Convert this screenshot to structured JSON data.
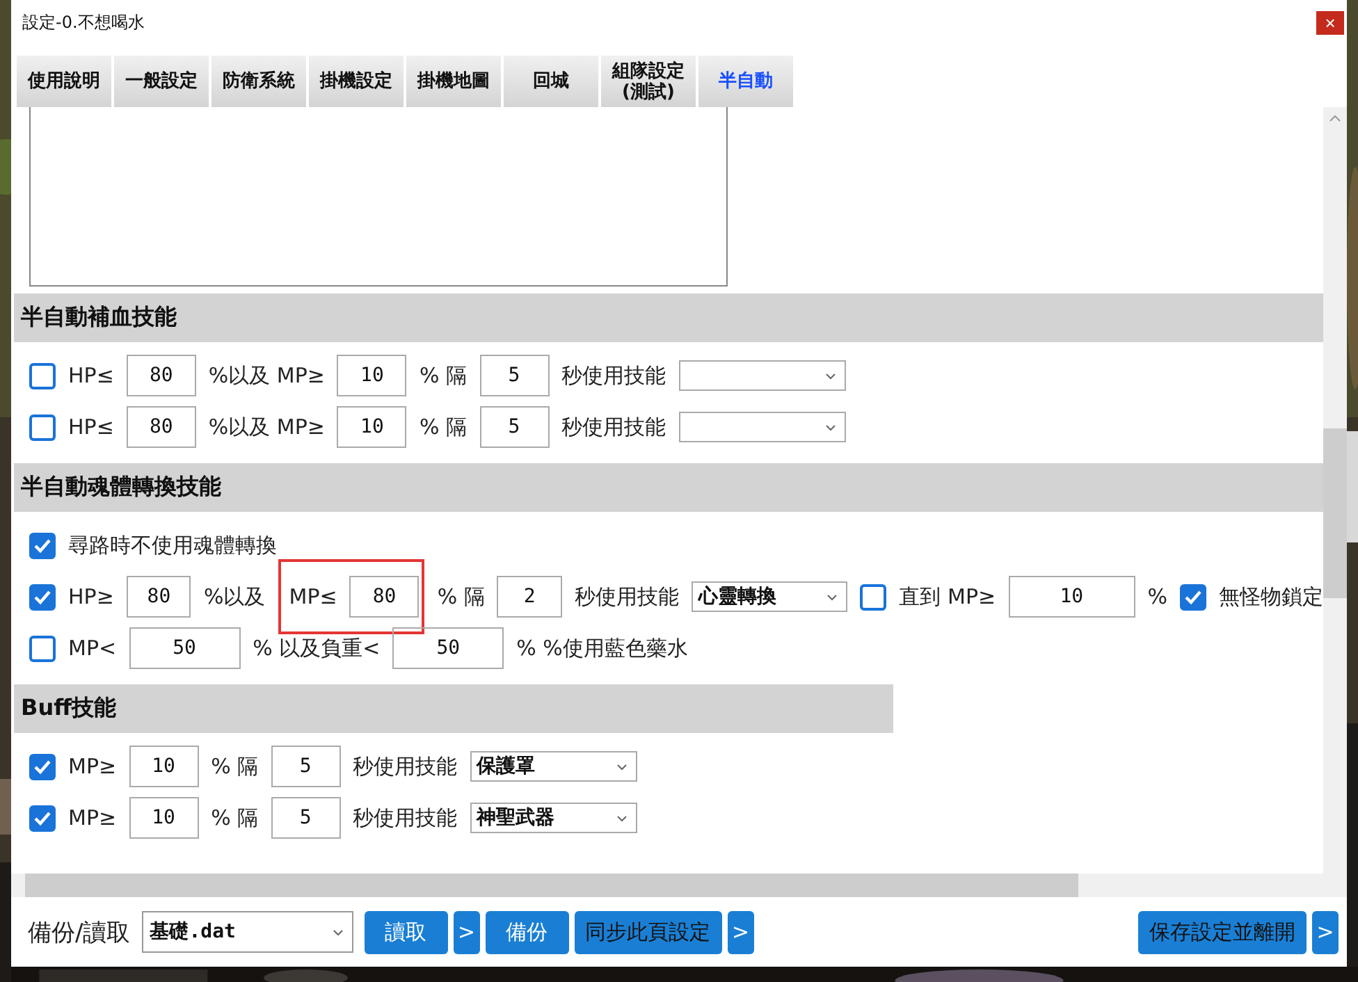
{
  "window": {
    "title": "設定-0.不想喝水",
    "close": "×"
  },
  "tabs": [
    {
      "label": "使用說明",
      "selected": false
    },
    {
      "label": "一般設定",
      "selected": false
    },
    {
      "label": "防衛系統",
      "selected": false
    },
    {
      "label": "掛機設定",
      "selected": false
    },
    {
      "label": "掛機地圖",
      "selected": false
    },
    {
      "label": "回城",
      "selected": false
    },
    {
      "label": "組隊設定\n(測試)",
      "selected": false
    },
    {
      "label": "半自動",
      "selected": true
    }
  ],
  "sections": [
    {
      "title": "半自動補血技能",
      "kind": "wide",
      "rows": [
        {
          "items": [
            {
              "kind": "check",
              "checked": false
            },
            {
              "kind": "label",
              "text": "HP≤"
            },
            {
              "kind": "input",
              "value": "80"
            },
            {
              "kind": "label",
              "text": "%以及 MP≥"
            },
            {
              "kind": "input",
              "value": "10"
            },
            {
              "kind": "label",
              "text": "% 隔"
            },
            {
              "kind": "input",
              "value": "5"
            },
            {
              "kind": "label",
              "text": "秒使用技能"
            },
            {
              "kind": "select"
            }
          ]
        },
        {
          "items": [
            {
              "kind": "check",
              "checked": false
            },
            {
              "kind": "label",
              "text": "HP≤"
            },
            {
              "kind": "input",
              "value": "80"
            },
            {
              "kind": "label",
              "text": "%以及 MP≥"
            },
            {
              "kind": "input",
              "value": "10"
            },
            {
              "kind": "label",
              "text": "% 隔"
            },
            {
              "kind": "input",
              "value": "5"
            },
            {
              "kind": "label",
              "text": "秒使用技能"
            },
            {
              "kind": "select"
            }
          ]
        }
      ]
    },
    {
      "title": "半自動魂體轉換技能",
      "kind": "wide",
      "rows": [
        {
          "items": [
            {
              "kind": "check",
              "checked": true
            },
            {
              "kind": "label",
              "text": "尋路時不使用魂體轉換"
            }
          ]
        },
        {
          "items": [
            {
              "kind": "check",
              "checked": true
            },
            {
              "kind": "label",
              "text": "HP≥"
            },
            {
              "kind": "input",
              "value": "80"
            },
            {
              "kind": "label",
              "text": "%以及"
            },
            {
              "kind": "highlight",
              "items": [
                {
                  "kind": "label",
                  "text": "MP≤"
                },
                {
                  "kind": "input",
                  "value": "80"
                }
              ]
            },
            {
              "kind": "label",
              "text": "% 隔"
            },
            {
              "kind": "input",
              "value": "2"
            },
            {
              "kind": "label",
              "text": "秒使用技能"
            },
            {
              "kind": "select",
              "value": "心靈轉換"
            },
            {
              "kind": "check",
              "checked": false
            },
            {
              "kind": "label",
              "text": "直到 MP≥"
            },
            {
              "kind": "input-wide",
              "value": "10"
            },
            {
              "kind": "label",
              "text": "%"
            },
            {
              "kind": "check",
              "checked": true
            },
            {
              "kind": "label",
              "text": "無怪物鎖定"
            }
          ]
        },
        {
          "items": [
            {
              "kind": "check",
              "checked": false
            },
            {
              "kind": "label",
              "text": "MP<"
            },
            {
              "kind": "input-mid",
              "value": "50"
            },
            {
              "kind": "label",
              "text": "% 以及負重<"
            },
            {
              "kind": "input-mid",
              "value": "50"
            },
            {
              "kind": "label",
              "text": "% %使用藍色藥水"
            }
          ]
        }
      ]
    },
    {
      "title": "Buff技能",
      "kind": "narrow",
      "rows": [
        {
          "items": [
            {
              "kind": "check",
              "checked": true
            },
            {
              "kind": "label",
              "text": "MP≥"
            },
            {
              "kind": "input",
              "value": "10"
            },
            {
              "kind": "label",
              "text": "% 隔"
            },
            {
              "kind": "input",
              "value": "5"
            },
            {
              "kind": "label",
              "text": "秒使用技能"
            },
            {
              "kind": "select",
              "value": "保護罩"
            }
          ]
        },
        {
          "items": [
            {
              "kind": "check",
              "checked": true
            },
            {
              "kind": "label",
              "text": "MP≥"
            },
            {
              "kind": "input",
              "value": "10"
            },
            {
              "kind": "label",
              "text": "% 隔"
            },
            {
              "kind": "input",
              "value": "5"
            },
            {
              "kind": "label",
              "text": "秒使用技能"
            },
            {
              "kind": "select",
              "value": "神聖武器"
            }
          ]
        }
      ]
    }
  ],
  "footer": {
    "label": "備份/讀取",
    "file": "基礎.dat",
    "left_buttons": [
      {
        "label": "讀取",
        "kind": "action"
      },
      {
        "label": ">",
        "kind": "more"
      },
      {
        "label": "備份",
        "kind": "action"
      },
      {
        "label": "同步此頁設定",
        "kind": "long"
      },
      {
        "label": ">",
        "kind": "more"
      }
    ],
    "right_buttons": [
      {
        "label": "保存設定並離開",
        "kind": "long"
      },
      {
        "label": ">",
        "kind": "more"
      }
    ]
  }
}
